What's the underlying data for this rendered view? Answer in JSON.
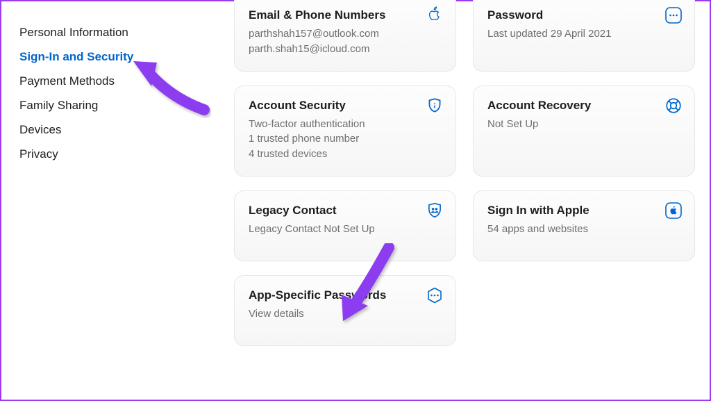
{
  "sidebar": {
    "items": [
      {
        "label": "Personal Information",
        "active": false
      },
      {
        "label": "Sign-In and Security",
        "active": true
      },
      {
        "label": "Payment Methods",
        "active": false
      },
      {
        "label": "Family Sharing",
        "active": false
      },
      {
        "label": "Devices",
        "active": false
      },
      {
        "label": "Privacy",
        "active": false
      }
    ]
  },
  "cards": {
    "email": {
      "title": "Email & Phone Numbers",
      "line1": "parthshah157@outlook.com",
      "line2": "parth.shah15@icloud.com"
    },
    "password": {
      "title": "Password",
      "line1": "Last updated 29 April 2021"
    },
    "accountSecurity": {
      "title": "Account Security",
      "line1": "Two-factor authentication",
      "line2": "1 trusted phone number",
      "line3": "4 trusted devices"
    },
    "accountRecovery": {
      "title": "Account Recovery",
      "line1": "Not Set Up"
    },
    "legacy": {
      "title": "Legacy Contact",
      "line1": "Legacy Contact Not Set Up"
    },
    "siwa": {
      "title": "Sign In with Apple",
      "line1": "54 apps and websites"
    },
    "appPasswords": {
      "title": "App-Specific Passwords",
      "line1": "View details"
    }
  },
  "colors": {
    "accent": "#0066cc",
    "arrow": "#8d3cf0"
  }
}
